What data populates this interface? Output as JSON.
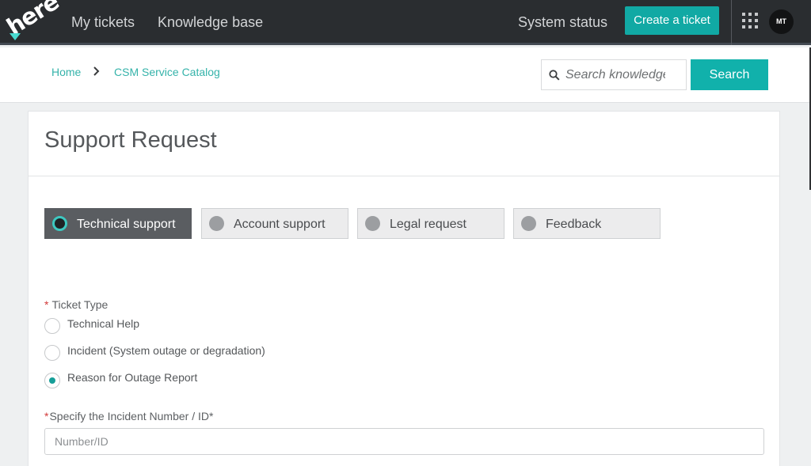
{
  "header": {
    "logo_text": "here",
    "nav": [
      "My tickets",
      "Knowledge base"
    ],
    "system_status": "System status",
    "create_ticket": "Create a ticket",
    "avatar_initials": "MT"
  },
  "breadcrumb": {
    "home": "Home",
    "catalog": "CSM Service Catalog"
  },
  "search": {
    "placeholder": "Search knowledge",
    "button": "Search"
  },
  "form": {
    "title": "Support Request",
    "categories": [
      {
        "label": "Technical support",
        "active": true
      },
      {
        "label": "Account support",
        "active": false
      },
      {
        "label": "Legal request",
        "active": false
      },
      {
        "label": "Feedback",
        "active": false
      }
    ],
    "required_mark": "*",
    "ticket_type_label": "Ticket Type",
    "ticket_types": [
      {
        "label": "Technical Help",
        "checked": false
      },
      {
        "label": "Incident (System outage or degradation)",
        "checked": false
      },
      {
        "label": "Reason for Outage Report",
        "checked": true
      }
    ],
    "incident_label": "Specify the Incident Number / ID*",
    "incident_placeholder": "Number/ID"
  },
  "colors": {
    "accent": "#11b1ab",
    "topbar": "#2a2d30",
    "required": "#d23a3a"
  }
}
